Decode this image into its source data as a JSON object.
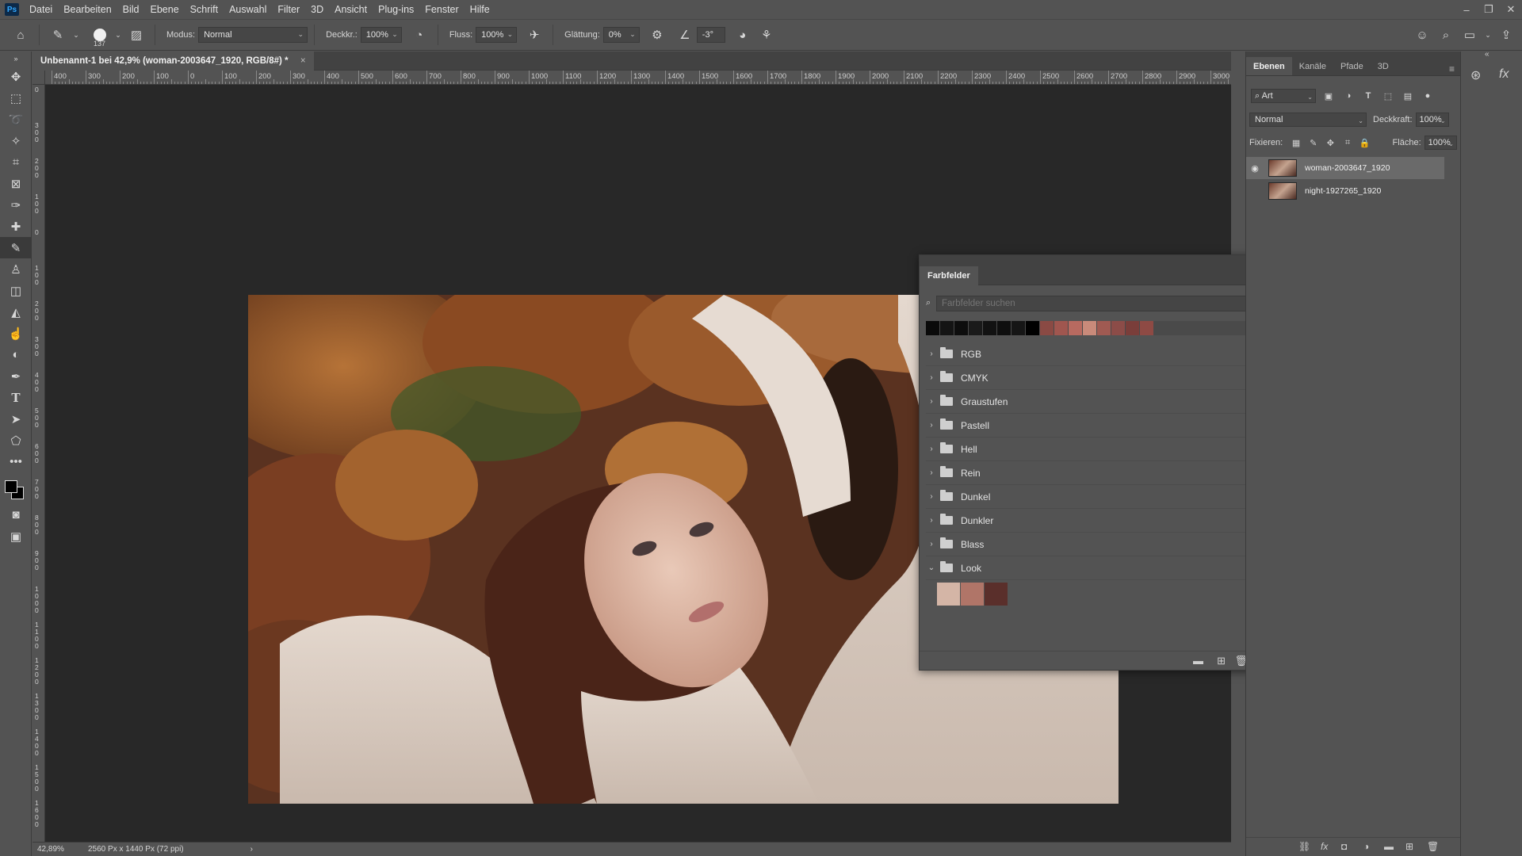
{
  "app": {
    "logo": "Ps",
    "menu": [
      "Datei",
      "Bearbeiten",
      "Bild",
      "Ebene",
      "Schrift",
      "Auswahl",
      "Filter",
      "3D",
      "Ansicht",
      "Plug-ins",
      "Fenster",
      "Hilfe"
    ]
  },
  "options": {
    "brush_size": "137",
    "modus_label": "Modus:",
    "modus_value": "Normal",
    "deckkraft_label": "Deckkr.:",
    "deckkraft_value": "100%",
    "fluss_label": "Fluss:",
    "fluss_value": "100%",
    "glaettung_label": "Glättung:",
    "glaettung_value": "0%",
    "angle_value": "-3°"
  },
  "document": {
    "tab_title": "Unbenannt-1 bei 42,9% (woman-2003647_1920, RGB/8#) *",
    "tab_close": "×"
  },
  "rulers": {
    "horizontal": [
      "400",
      "300",
      "200",
      "100",
      "0",
      "100",
      "200",
      "300",
      "400",
      "500",
      "600",
      "700",
      "800",
      "900",
      "1000",
      "1100",
      "1200",
      "1300",
      "1400",
      "1500",
      "1600",
      "1700",
      "1800",
      "1900",
      "2000",
      "2100",
      "2200",
      "2300",
      "2400",
      "2500",
      "2600",
      "2700",
      "2800",
      "2900",
      "3000"
    ],
    "vertical": [
      "0",
      "300",
      "200",
      "100",
      "0",
      "100",
      "200",
      "300",
      "400",
      "500",
      "600",
      "700",
      "800",
      "900",
      "1000",
      "1100",
      "1200",
      "1300",
      "1400",
      "1500",
      "1600"
    ]
  },
  "status": {
    "zoom": "42,89%",
    "size": "2560 Px x 1440 Px (72 ppi)",
    "arrow": "›"
  },
  "swatches": {
    "title": "Farbfelder",
    "search_placeholder": "Farbfelder suchen",
    "recent_colors": [
      "#0a0a0a",
      "#141414",
      "#0d0d0d",
      "#1a1a1a",
      "#121212",
      "#0f0f0f",
      "#161616",
      "#000000",
      "#8a4a44",
      "#a0564f",
      "#b86a60",
      "#c98a7a",
      "#a05a52",
      "#8c4c48",
      "#7a3e3a",
      "#8e4a44"
    ],
    "groups": [
      {
        "label": "RGB",
        "expanded": false
      },
      {
        "label": "CMYK",
        "expanded": false
      },
      {
        "label": "Graustufen",
        "expanded": false
      },
      {
        "label": "Pastell",
        "expanded": false
      },
      {
        "label": "Hell",
        "expanded": false
      },
      {
        "label": "Rein",
        "expanded": false
      },
      {
        "label": "Dunkel",
        "expanded": false
      },
      {
        "label": "Dunkler",
        "expanded": false
      },
      {
        "label": "Blass",
        "expanded": false
      },
      {
        "label": "Look",
        "expanded": true
      }
    ],
    "look_colors": [
      "#d4b5a6",
      "#b07568",
      "#5a2f2b"
    ]
  },
  "layers_panel": {
    "tabs": [
      "Ebenen",
      "Kanäle",
      "Pfade",
      "3D"
    ],
    "filter_value": "Art",
    "blend_mode": "Normal",
    "opacity_label": "Deckkraft:",
    "opacity_value": "100%",
    "lock_label": "Fixieren:",
    "fill_label": "Fläche:",
    "fill_value": "100%",
    "layers": [
      {
        "name": "woman-2003647_1920",
        "visible": true,
        "selected": true
      },
      {
        "name": "night-1927265_1920",
        "visible": false,
        "selected": false
      }
    ]
  },
  "colors": {
    "foreground": "#000000",
    "background": "#000000",
    "ui_bg": "#535353",
    "canvas_bg": "#282828"
  }
}
